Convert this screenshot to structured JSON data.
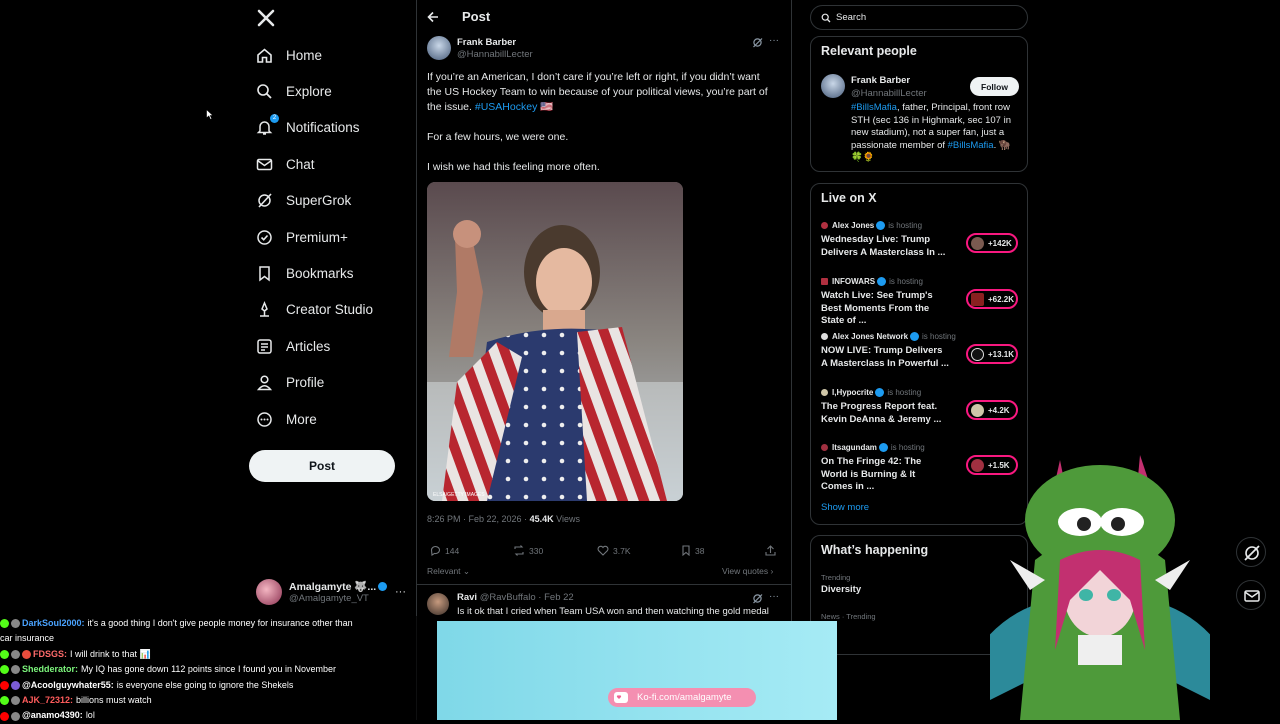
{
  "nav": {
    "items": [
      {
        "label": "Home",
        "icon": "home-icon"
      },
      {
        "label": "Explore",
        "icon": "search-icon"
      },
      {
        "label": "Notifications",
        "icon": "bell-icon"
      },
      {
        "label": "Chat",
        "icon": "mail-icon"
      },
      {
        "label": "SuperGrok",
        "icon": "grok-icon"
      },
      {
        "label": "Premium+",
        "icon": "premium-icon"
      },
      {
        "label": "Bookmarks",
        "icon": "bookmark-icon"
      },
      {
        "label": "Creator Studio",
        "icon": "creator-icon"
      },
      {
        "label": "Articles",
        "icon": "articles-icon"
      },
      {
        "label": "Profile",
        "icon": "profile-icon"
      },
      {
        "label": "More",
        "icon": "more-icon"
      }
    ],
    "notif_badge": "2",
    "post_button": "Post"
  },
  "account": {
    "name": "Amalgamyte 🐺...",
    "handle": "@Amalgamyte_VT"
  },
  "post": {
    "header": "Post",
    "author_name": "Frank Barber",
    "author_handle": "@HannabillLecter",
    "para1": "If you’re an American, I don’t care if you’re left or right, if you didn’t want the US Hockey Team to win because of your political views, you’re part of the issue.",
    "hashtag": "#USAHockey 🇺🇸",
    "para2": "For a few hours, we were one.",
    "para3": "I wish we had this feeling more often.",
    "photo_credit": "ELSA/GETTY IMAGES",
    "time": "8:26 PM · Feb 22, 2026 ·",
    "views": "45.4K",
    "views_label": "Views",
    "replies": "144",
    "reposts": "330",
    "likes": "3.7K",
    "bookmarks": "38",
    "relevant": "Relevant",
    "view_quotes": "View quotes"
  },
  "reply": {
    "name": "Ravi",
    "handle": "@RavBuffalo · Feb 22",
    "text": "Is it ok that I cried when Team USA won and then watching the gold medal"
  },
  "search": {
    "placeholder": "Search"
  },
  "relevant_people": {
    "title": "Relevant people",
    "name": "Frank Barber",
    "handle": "@HannabillLecter",
    "follow": "Follow",
    "bio_tag1": "#BillsMafia",
    "bio_main": ", father, Principal, front row STH (sec 136 in Highmark, sec 107 in new stadium), not a super fan, just a passionate member of ",
    "bio_tag2": "#BillsMafia",
    "bio_end": ". 🦬 🍀🌻"
  },
  "live": {
    "title": "Live on X",
    "hosting": "is hosting",
    "items": [
      {
        "host": "Alex Jones",
        "title": "Wednesday Live: Trump Delivers A Masterclass In ...",
        "count": "+142K"
      },
      {
        "host": "INFOWARS",
        "title": "Watch Live: See Trump's Best Moments From the State of ...",
        "count": "+62.2K"
      },
      {
        "host": "Alex Jones Network",
        "title": "NOW LIVE: Trump Delivers A Masterclass In Powerful ...",
        "count": "+13.1K"
      },
      {
        "host": "I,Hypocrite",
        "title": "The Progress Report feat. Kevin DeAnna & Jeremy ...",
        "count": "+4.2K"
      },
      {
        "host": "Itsagundam",
        "title": "On The Fringe 42: The World is Burning & It Comes in ...",
        "count": "+1.5K"
      }
    ],
    "show_more": "Show more"
  },
  "happening": {
    "title": "What’s happening",
    "trend_label": "Trending",
    "trend_name": "Diversity",
    "next_label": "News · Trending"
  },
  "chat": [
    {
      "user": "DarkSoul2000:",
      "msg": "it's a good thing I don't give people money for insurance other than"
    },
    {
      "user": "",
      "msg": "car insurance"
    },
    {
      "user": "FDSGS:",
      "msg": "I will drink to that 📊"
    },
    {
      "user": "Shedderator:",
      "msg": "My IQ has gone down 112 points since I found you in November"
    },
    {
      "user": "@Acoolguywhater55:",
      "msg": "is everyone else going to ignore the Shekels"
    },
    {
      "user": "AJK_72312:",
      "msg": "billions must watch"
    },
    {
      "user": "@anamo4390:",
      "msg": "lol"
    }
  ],
  "kofi": "Ko-fi.com/amalgamyte",
  "colors": {
    "accent": "#1d9bf0",
    "live_ring": "#f91880",
    "kofi": "#f48fb1"
  }
}
